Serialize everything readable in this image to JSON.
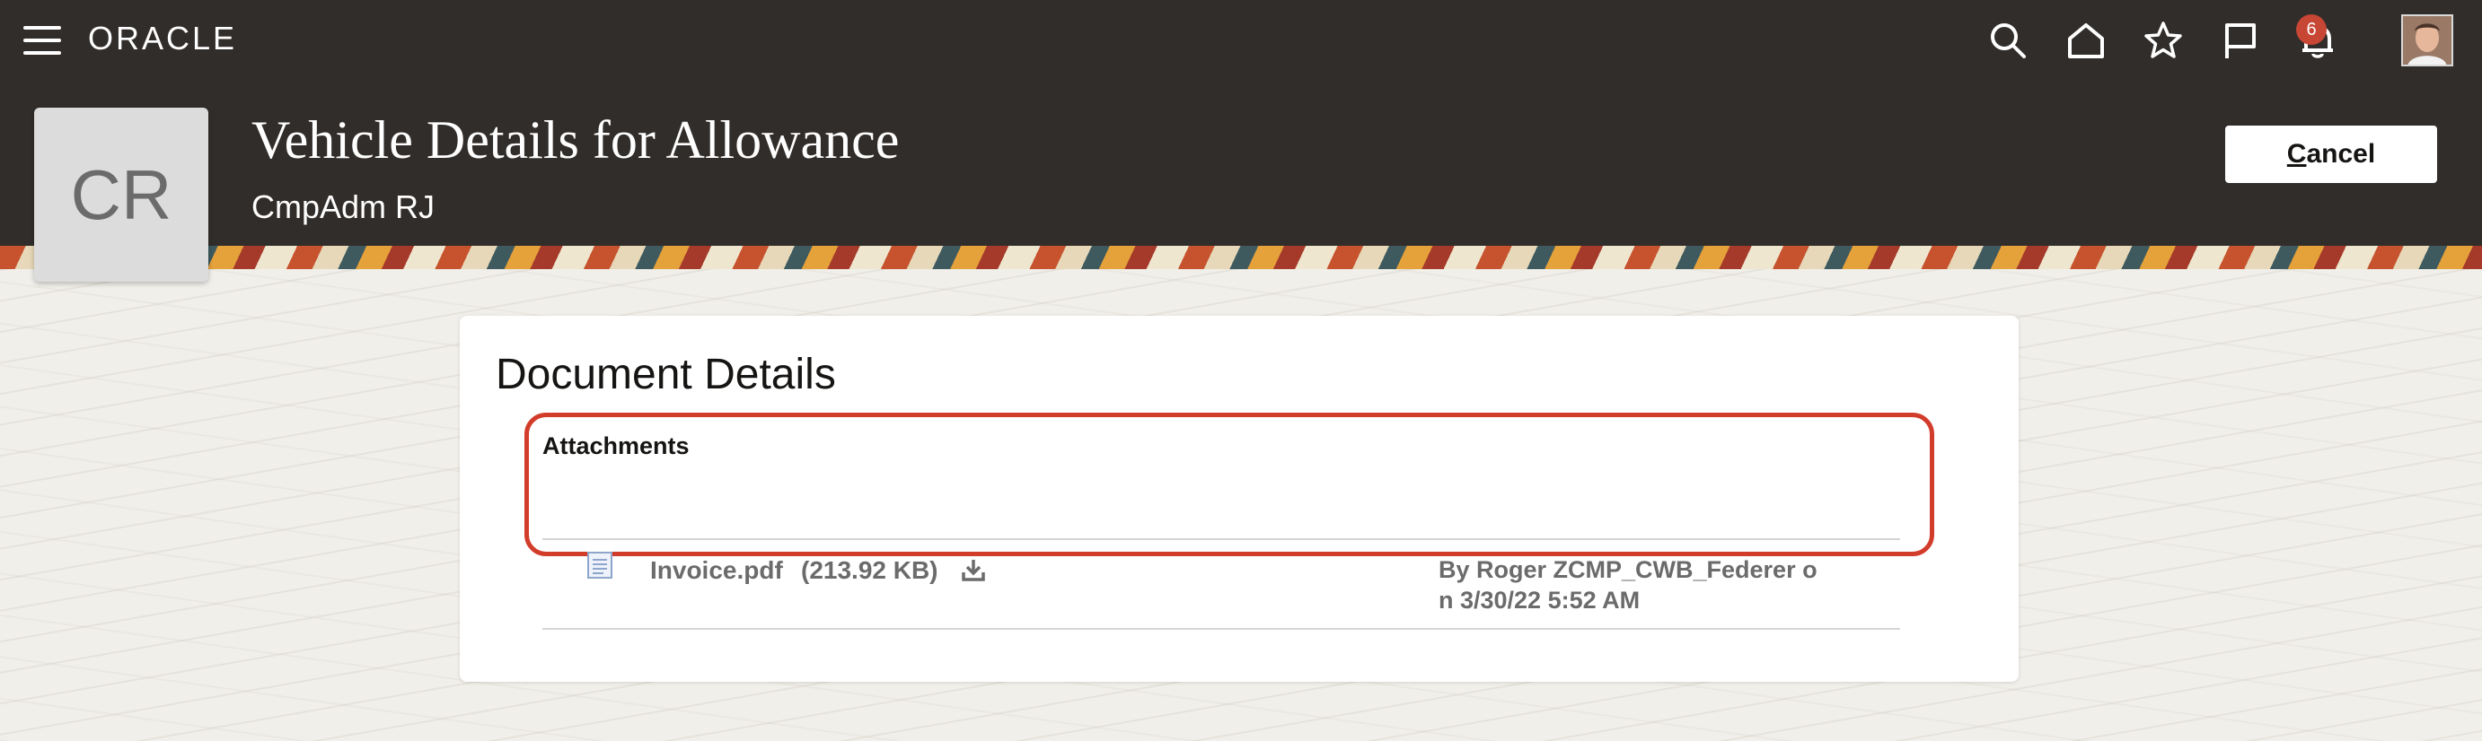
{
  "topbar": {
    "logo": "ORACLE",
    "icons": [
      "menu-icon",
      "search-icon",
      "home-icon",
      "star-icon",
      "flag-icon",
      "bell-icon",
      "user-avatar"
    ],
    "notification_count": "6"
  },
  "header": {
    "tile_initials": "CR",
    "title": "Vehicle Details for Allowance",
    "subtitle": "CmpAdm RJ",
    "cancel_label_first": "C",
    "cancel_label_rest": "ancel"
  },
  "card": {
    "title": "Document Details",
    "attachments": {
      "title": "Attachments",
      "items": [
        {
          "file_name": "Invoice.pdf",
          "file_size": "(213.92 KB)",
          "uploader": "By Roger ZCMP_CWB_Federer o",
          "uploader_cont": "n 3/30/22 5:52 AM"
        }
      ]
    }
  },
  "colors": {
    "bar": "#312d2a",
    "badge": "#c74634",
    "highlight": "#d23c2a"
  }
}
